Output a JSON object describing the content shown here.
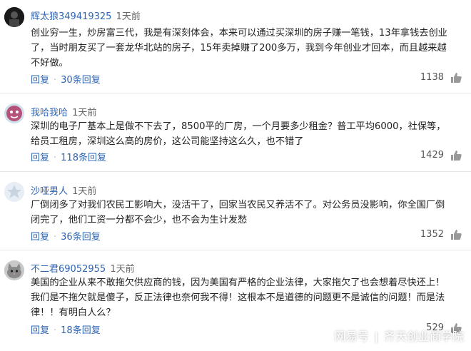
{
  "comments": [
    {
      "username": "辉太狼349419325",
      "time": "1天前",
      "lines": [
        "创业穷一生，炒房富三代，我是有深刻体会，本来可以通过买深圳的房子赚一笔钱，13年拿钱去创业",
        "了，当时朋友买了一套龙华北站的房子，15年卖掉赚了200多万，我到今年创业才回本，而且越来越",
        "不好做。"
      ],
      "reply_label": "回复",
      "replies_label": "30条回复",
      "likes": "1138",
      "avatar": "avatar-dark-icon"
    },
    {
      "username": "我哈我哈",
      "time": "1天前",
      "lines": [
        "深圳的电子厂基本上是做不下去了，8500平的厂房，一个月要多少租金？普工平均6000，社保等，",
        "给员工租房，深圳这么高的房价，这公司能坚持这么久，也不错了"
      ],
      "reply_label": "回复",
      "replies_label": "118条回复",
      "likes": "1429",
      "avatar": "avatar-cartoon-icon"
    },
    {
      "username": "沙哑男人",
      "time": "1天前",
      "lines": [
        "厂倒闭多了对我们农民工影响大，没活干了，回家当农民又养活不了。对公务员没影响，你全国厂倒",
        "闭完了，他们工资一分都不会少，也不会为生计发愁"
      ],
      "reply_label": "回复",
      "replies_label": "36条回复",
      "likes": "1352",
      "avatar": "avatar-star-icon"
    },
    {
      "username": "不二君69052955",
      "time": "1天前",
      "lines": [
        "美国的企业从来不敢拖欠供应商的钱，因为美国有严格的企业法律，大家拖欠了也会想着尽快还上！",
        "我们是不拖欠就是傻子，反正法律也奈何我不得！这根本不是道德的问题更不是诚信的问题！而是法",
        "律！！有明白人么？"
      ],
      "reply_label": "回复",
      "replies_label": "18条回复",
      "likes": "529",
      "avatar": "avatar-cat-icon"
    }
  ],
  "watermark": {
    "platform": "网易号",
    "source": "齐天创业商学院"
  },
  "colors": {
    "link": "#2d64b3",
    "text": "#222222",
    "divider": "#e6e6e6"
  }
}
